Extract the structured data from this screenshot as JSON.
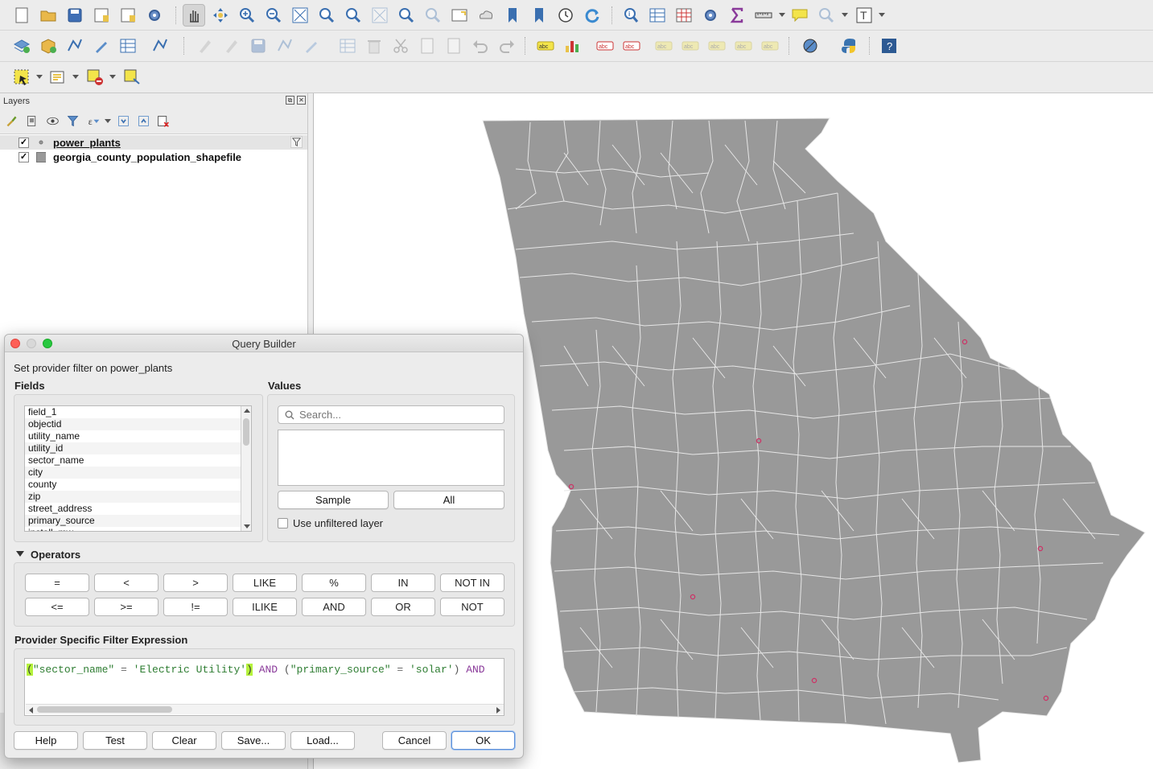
{
  "toolbar1": {
    "icons": [
      "new-project-icon",
      "open-project-icon",
      "save-project-icon",
      "new-print-layout-icon",
      "layout-manager-icon",
      "style-manager-icon",
      "pan-map-icon",
      "pan-to-selection-icon",
      "zoom-in-icon",
      "zoom-out-icon",
      "zoom-full-icon",
      "zoom-to-selection-icon",
      "zoom-to-layer-icon",
      "zoom-native-icon",
      "zoom-last-icon",
      "zoom-next-icon",
      "new-map-view-icon",
      "new-3d-map-view-icon",
      "new-bookmark-icon",
      "show-bookmarks-icon",
      "temporal-controller-icon",
      "refresh-icon",
      "identify-icon",
      "attribute-table-icon",
      "field-calculator-icon",
      "toolbox-icon",
      "statistics-icon",
      "measure-icon",
      "map-tips-icon",
      "locator-icon",
      "text-annotation-icon"
    ]
  },
  "toolbar2": {
    "icons": [
      "data-source-manager-icon",
      "new-geopackage-layer-icon",
      "new-shapefile-layer-icon",
      "new-spatialite-layer-icon",
      "new-temporary-layer-icon",
      "new-virtual-layer-icon",
      "edit-icon",
      "toggle-editing-icon",
      "save-edits-icon",
      "digitize-icon",
      "vertex-tool-icon",
      "modify-attributes-icon",
      "delete-selected-icon",
      "cut-features-icon",
      "copy-features-icon",
      "paste-features-icon",
      "undo-icon",
      "redo-icon",
      "label-tool-icon",
      "diagram-tool-icon",
      "highlight-pinned-labels-icon",
      "pin-labels-icon",
      "show-hide-labels-icon",
      "move-label-icon",
      "rotate-label-icon",
      "change-label-icon",
      "label-properties-icon",
      "georeferencer-icon",
      "python-console-icon",
      "help-icon"
    ]
  },
  "toolbar3": {
    "icons": [
      "select-features-icon",
      "select-by-value-icon",
      "deselect-all-icon",
      "identify-selection-icon"
    ]
  },
  "layers_panel": {
    "title": "Layers",
    "layers": [
      {
        "name": "power_plants",
        "checked": true,
        "filtered": true
      },
      {
        "name": "georgia_county_population_shapefile",
        "checked": true,
        "filtered": false
      }
    ]
  },
  "map": {
    "fill": "#999999",
    "stroke": "#e8e8e8",
    "point_color": "#cc3366"
  },
  "dialog": {
    "title": "Query Builder",
    "subtitle": "Set provider filter on power_plants",
    "fields_label": "Fields",
    "fields": [
      "field_1",
      "objectid",
      "utility_name",
      "utility_id",
      "sector_name",
      "city",
      "county",
      "zip",
      "street_address",
      "primary_source",
      "install_mw"
    ],
    "values_label": "Values",
    "search_placeholder": "Search...",
    "sample_label": "Sample",
    "all_label": "All",
    "use_unfiltered_label": "Use unfiltered layer",
    "operators_label": "Operators",
    "operators_row1": [
      "=",
      "<",
      ">",
      "LIKE",
      "%",
      "IN",
      "NOT IN"
    ],
    "operators_row2": [
      "<=",
      ">=",
      "!=",
      "ILIKE",
      "AND",
      "OR",
      "NOT"
    ],
    "expression_label": "Provider Specific Filter Expression",
    "expression": "(\"sector_name\" = 'Electric Utility') AND (\"primary_source\" = 'solar') AND",
    "buttons": {
      "help": "Help",
      "test": "Test",
      "clear": "Clear",
      "save": "Save...",
      "load": "Load...",
      "cancel": "Cancel",
      "ok": "OK"
    }
  }
}
